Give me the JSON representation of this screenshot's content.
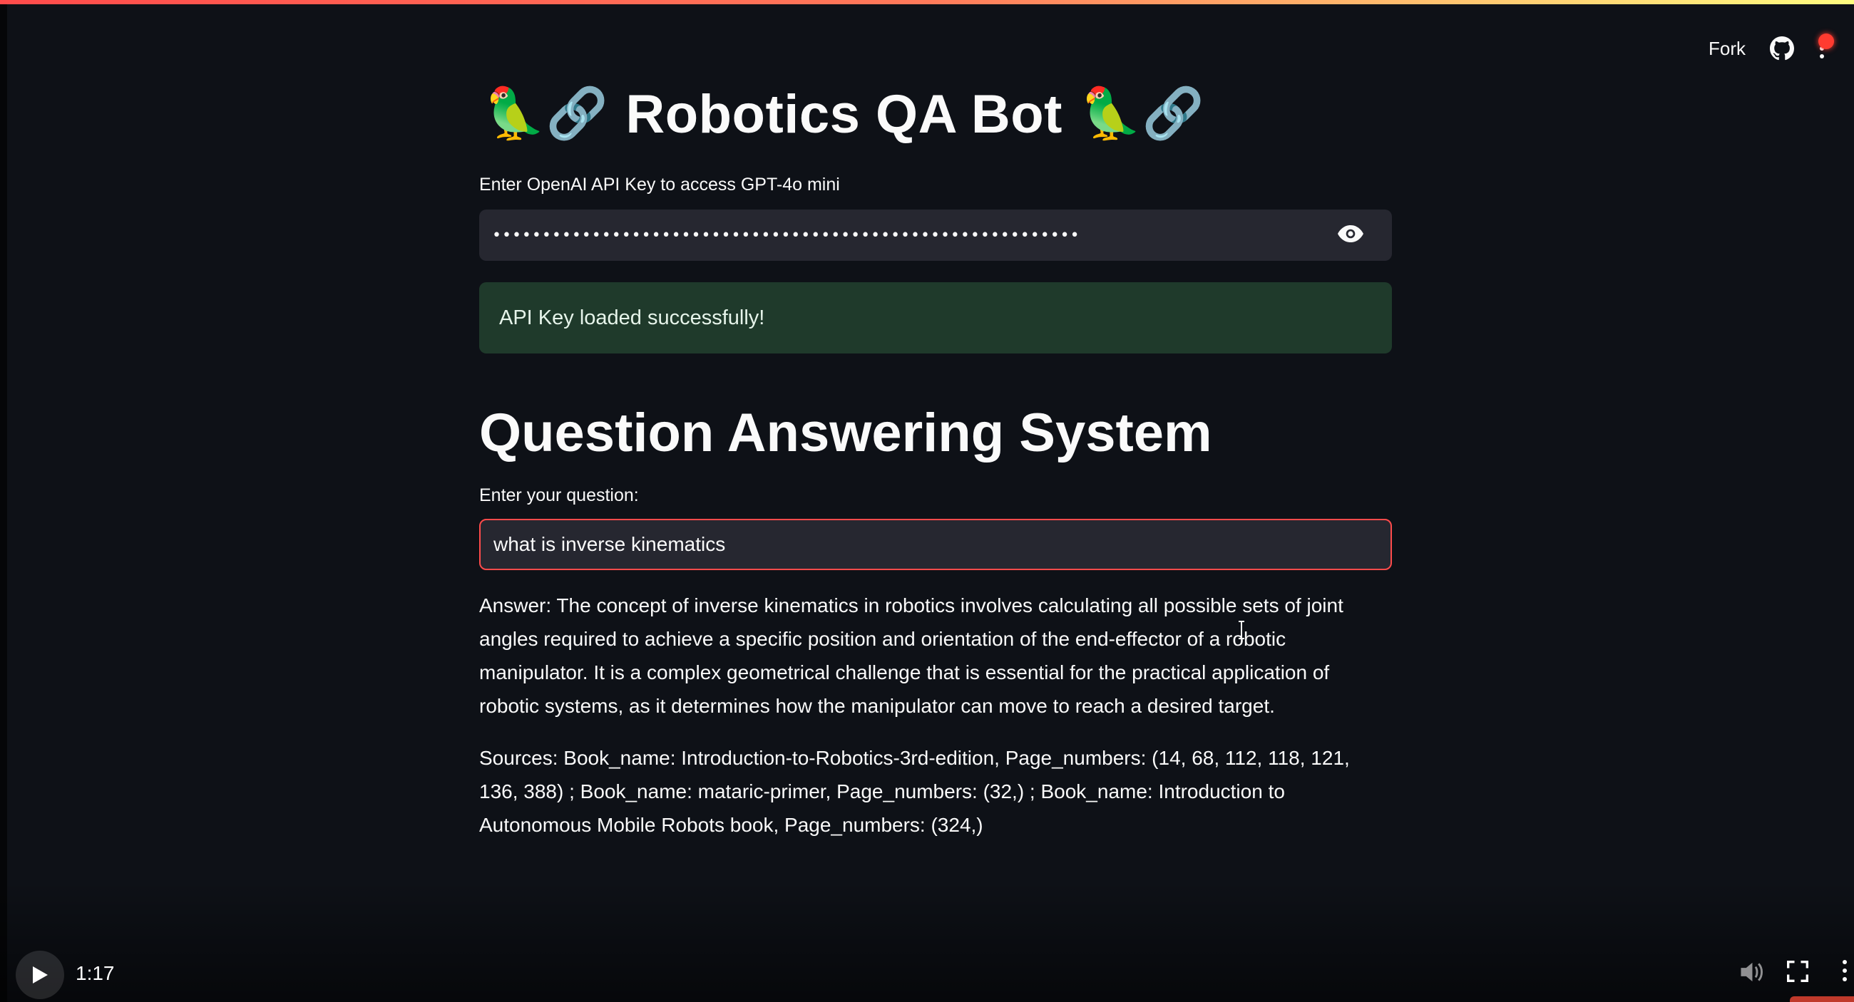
{
  "header": {
    "fork_label": "Fork"
  },
  "app": {
    "title_emoji_left": "🦜🔗",
    "title": "Robotics QA Bot",
    "title_emoji_right": "🦜🔗"
  },
  "api_key": {
    "label": "Enter OpenAI API Key to access GPT-4o mini",
    "value": "•••••••••••••••••••••••••••••••••••••••••••••••••••••••••••",
    "success_message": "API Key loaded successfully!"
  },
  "qa": {
    "section_title": "Question Answering System",
    "question_label": "Enter your question:",
    "question_value": "what is inverse kinematics",
    "answer": "Answer: The concept of inverse kinematics in robotics involves calculating all possible sets of joint angles required to achieve a specific position and orientation of the end-effector of a robotic manipulator. It is a complex geometrical challenge that is essential for the practical application of robotic systems, as it determines how the manipulator can move to reach a desired target.",
    "sources": "Sources: Book_name: Introduction-to-Robotics-3rd-edition, Page_numbers: (14, 68, 112, 118, 121, 136, 388) ; Book_name: mataric-primer, Page_numbers: (32,) ; Book_name: Introduction to Autonomous Mobile Robots book, Page_numbers: (324,)"
  },
  "player": {
    "time": "1:17"
  },
  "colors": {
    "background": "#0e1117",
    "input_bg": "#262730",
    "accent": "#ff4b4b",
    "success_bg": "#1f3a2b"
  },
  "icons": [
    "github-icon",
    "kebab-menu-icon",
    "eye-icon",
    "play-icon",
    "volume-icon",
    "fullscreen-icon",
    "more-vert-icon"
  ]
}
